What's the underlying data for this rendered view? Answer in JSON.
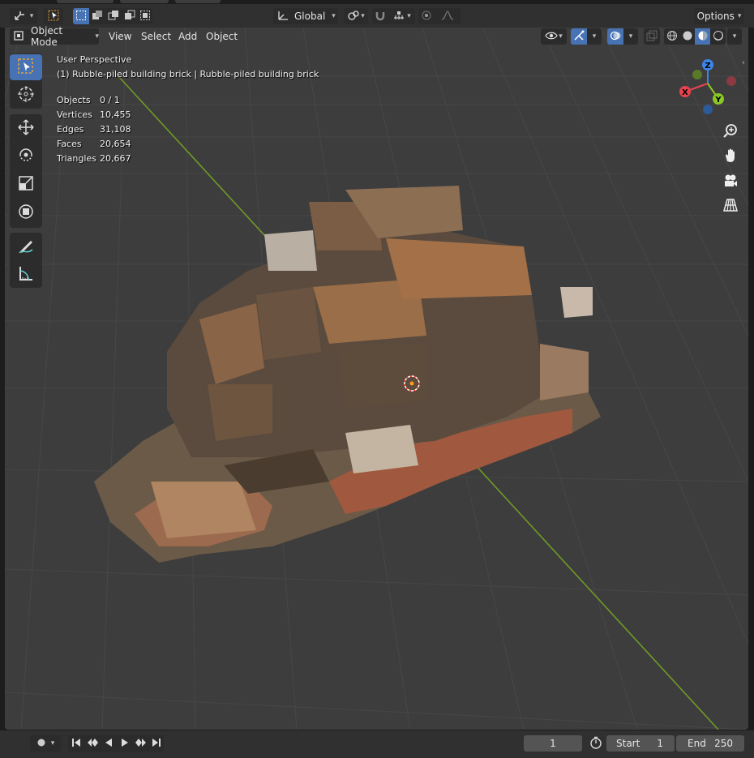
{
  "header": {
    "editor_type_icon": "transform-gizmo-icon",
    "transform_orientation": "Global",
    "options_label": "Options"
  },
  "menu": {
    "mode_label": "Object Mode",
    "view": "View",
    "select": "Select",
    "add": "Add",
    "object": "Object"
  },
  "overlay": {
    "perspective": "User Perspective",
    "object_name": "(1) Rubble-piled building brick | Rubble-piled building brick",
    "stats": [
      {
        "label": "Objects",
        "value": "0 / 1"
      },
      {
        "label": "Vertices",
        "value": "10,455"
      },
      {
        "label": "Edges",
        "value": "31,108"
      },
      {
        "label": "Faces",
        "value": "20,654"
      },
      {
        "label": "Triangles",
        "value": "20,667"
      }
    ]
  },
  "gizmo": {
    "x": "X",
    "y": "Y",
    "z": "Z"
  },
  "timeline": {
    "current_frame": "1",
    "start_label": "Start",
    "start_value": "1",
    "end_label": "End",
    "end_value": "250"
  },
  "colors": {
    "accent": "#4772b3",
    "axis_x": "#e8434f",
    "axis_y": "#8ac924",
    "axis_z": "#3c85e8",
    "viewport_bg": "#3d3d3d"
  }
}
